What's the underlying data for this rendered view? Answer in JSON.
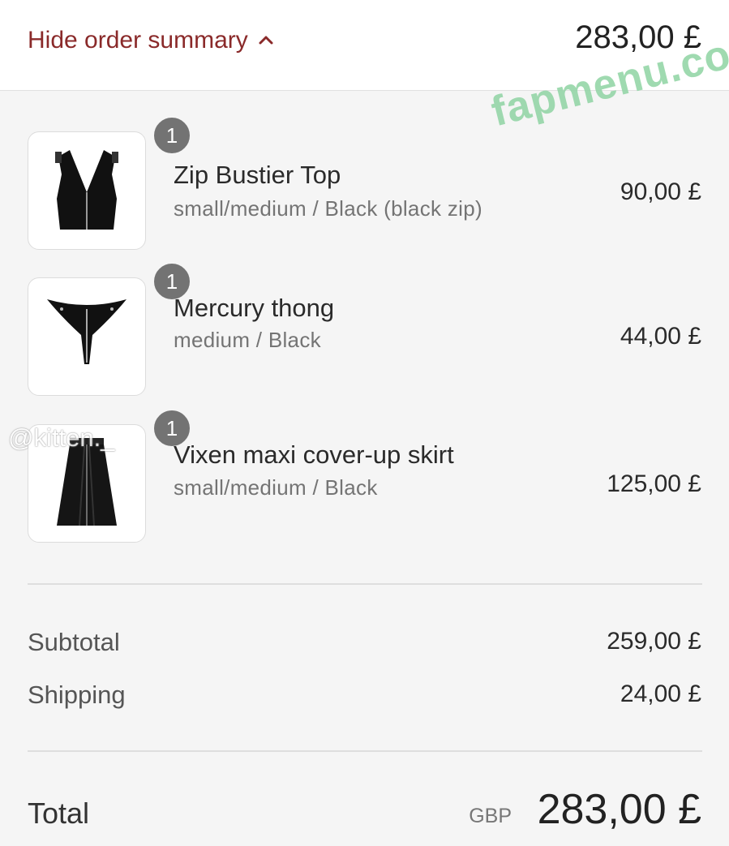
{
  "header": {
    "toggle_label": "Hide order summary",
    "toggle_icon": "chevron-up-icon",
    "total": "283,00 £"
  },
  "items": [
    {
      "quantity": "1",
      "name": "Zip Bustier Top",
      "variant": "small/medium / Black (black zip)",
      "price": "90,00 £",
      "image": "bustier-top-image"
    },
    {
      "quantity": "1",
      "name": "Mercury thong",
      "variant": "medium / Black",
      "price": "44,00 £",
      "image": "thong-image"
    },
    {
      "quantity": "1",
      "name": "Vixen maxi cover-up skirt",
      "variant": "small/medium / Black",
      "price": "125,00 £",
      "image": "skirt-image"
    }
  ],
  "costs": {
    "subtotal_label": "Subtotal",
    "subtotal_value": "259,00 £",
    "shipping_label": "Shipping",
    "shipping_value": "24,00 £"
  },
  "total": {
    "label": "Total",
    "currency": "GBP",
    "value": "283,00 £"
  },
  "watermarks": {
    "site": "fapmenu.com",
    "handle": "@kitten._"
  },
  "colors": {
    "accent": "#8a2a2a",
    "badge": "#737373",
    "background": "#f5f5f5"
  }
}
